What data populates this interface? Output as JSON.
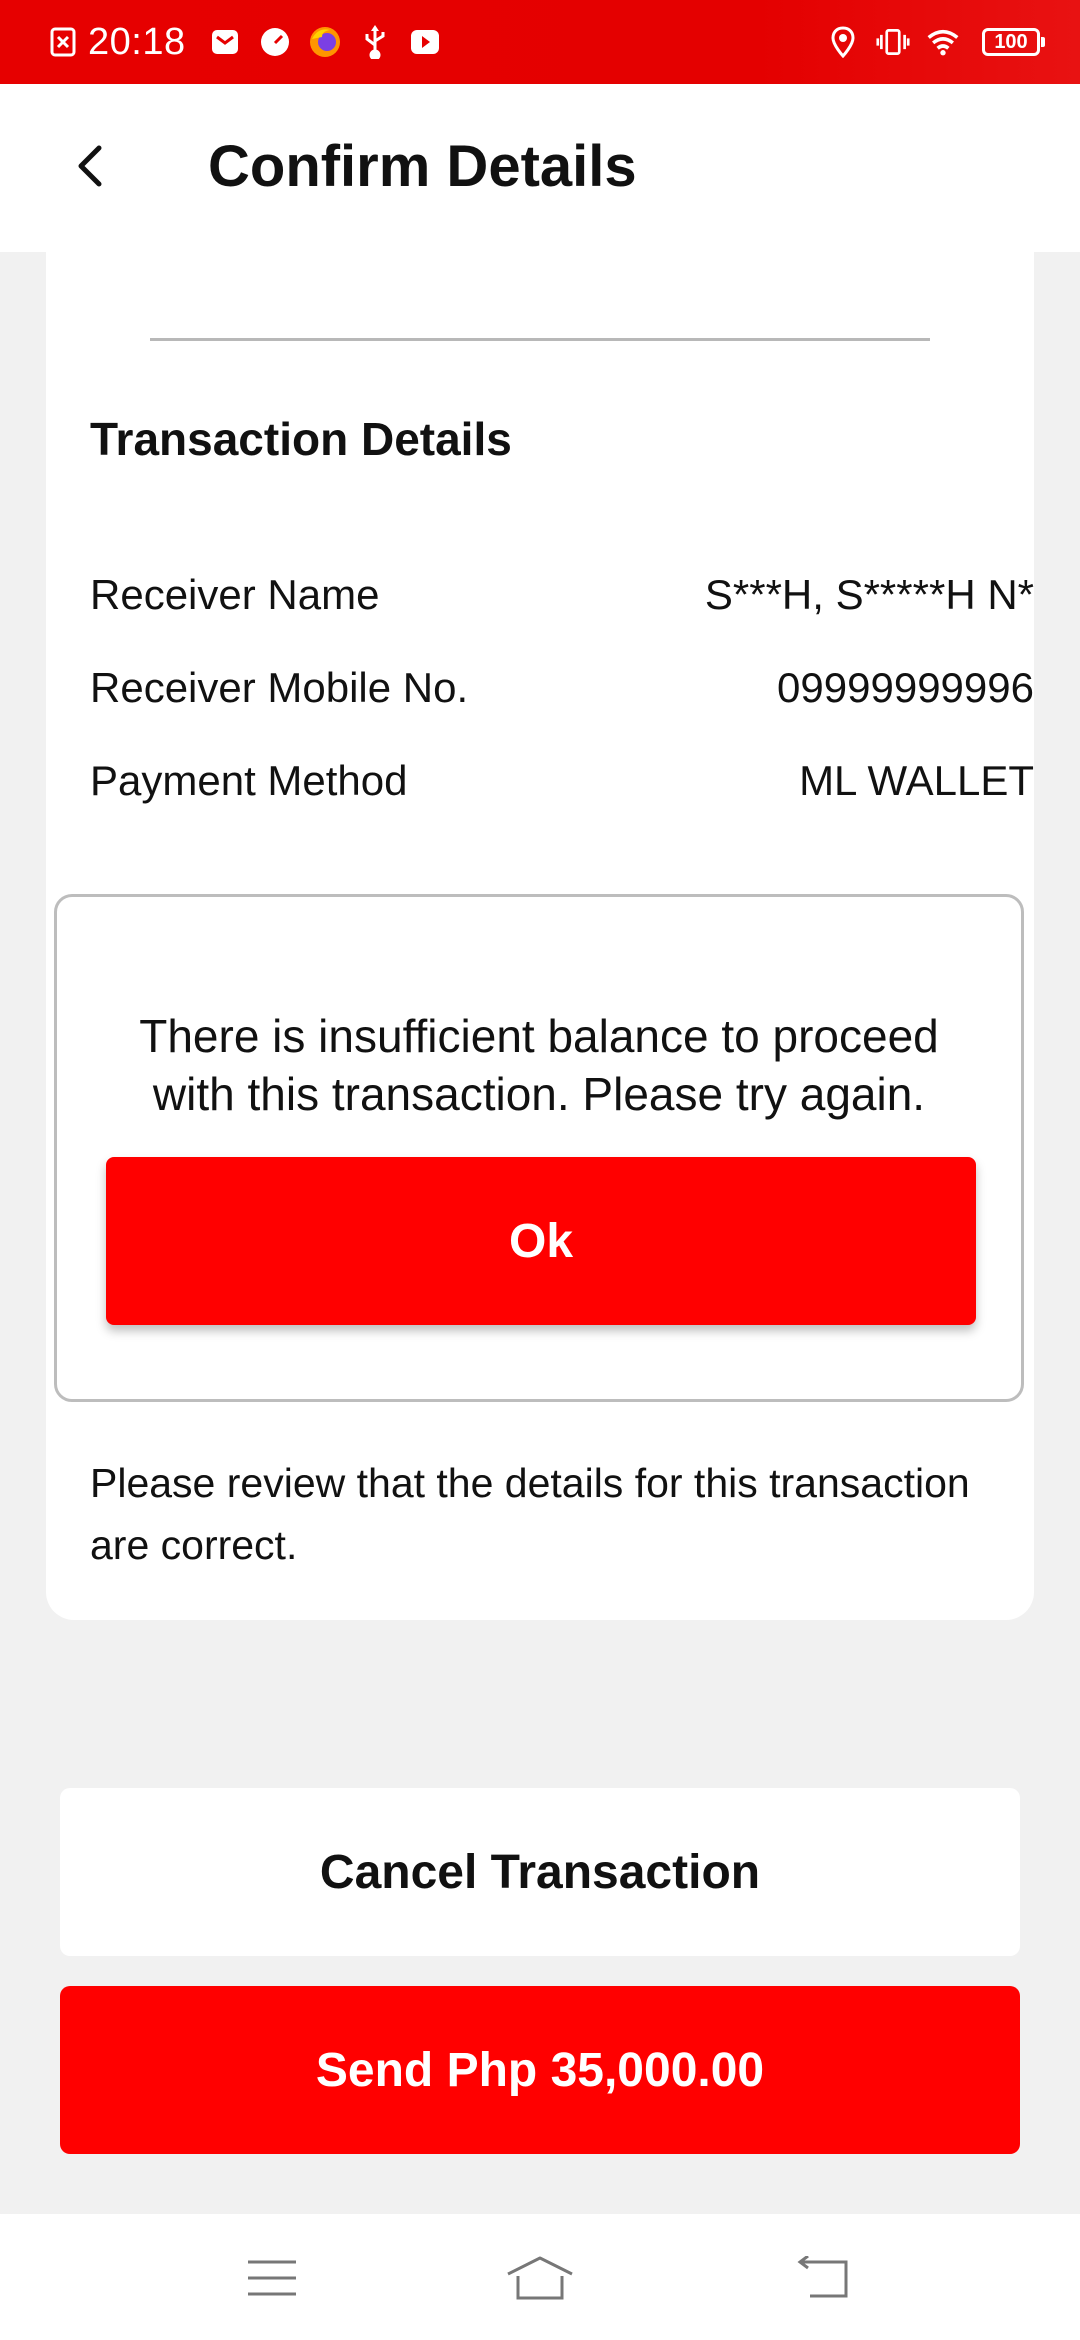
{
  "status_bar": {
    "time": "20:18",
    "battery": "100",
    "icons_left": [
      "screenshot-icon",
      "gmail-icon",
      "speedometer-icon",
      "firefox-icon",
      "usb-icon",
      "youtube-icon"
    ],
    "icons_right": [
      "location-icon",
      "vibrate-icon",
      "wifi-icon",
      "battery-icon"
    ],
    "background": "#e60000"
  },
  "header": {
    "title": "Confirm Details",
    "back_icon": "chevron-left-icon"
  },
  "transaction": {
    "section_title": "Transaction Details",
    "rows": [
      {
        "label": "Receiver Name",
        "value": "S***H, S*****H N*"
      },
      {
        "label": "Receiver Mobile No.",
        "value": "09999999996"
      },
      {
        "label": "Payment Method",
        "value": "ML WALLET"
      }
    ],
    "review_note": "Please review that the details for this transaction are correct."
  },
  "dialog": {
    "message": "There is insufficient balance to proceed with this transaction. Please try again.",
    "ok_label": "Ok"
  },
  "actions": {
    "cancel_label": "Cancel Transaction",
    "send_label": "Send Php 35,000.00"
  },
  "nav_bar": {
    "icons": [
      "menu-icon",
      "home-icon",
      "back-icon"
    ]
  },
  "colors": {
    "accent": "#ff0000",
    "page_background": "#f1f1f1",
    "card_background": "#ffffff"
  }
}
